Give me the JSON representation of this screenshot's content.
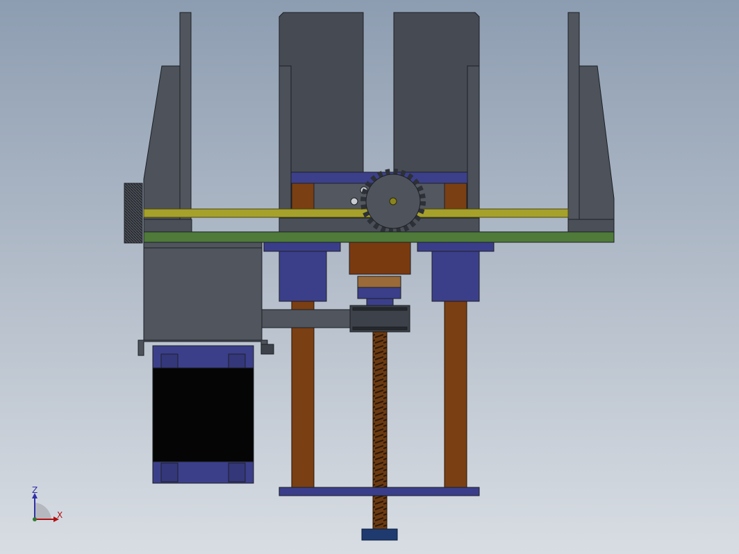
{
  "triad": {
    "z_label": "Z",
    "x_label": "X"
  },
  "colors": {
    "background_top": "#8d9db1",
    "background_bottom": "#d8dde3",
    "frame_grey": "#4d525b",
    "frame_edge": "#1c1f24",
    "base_plate": "#4f7a3a",
    "rod_yellow": "#a6a12a",
    "bearing_blue": "#3b3f8a",
    "guide_rod": "#7a3f13",
    "motor_black": "#050505",
    "axis_z": "#2f2fa8",
    "axis_x": "#b01010"
  }
}
